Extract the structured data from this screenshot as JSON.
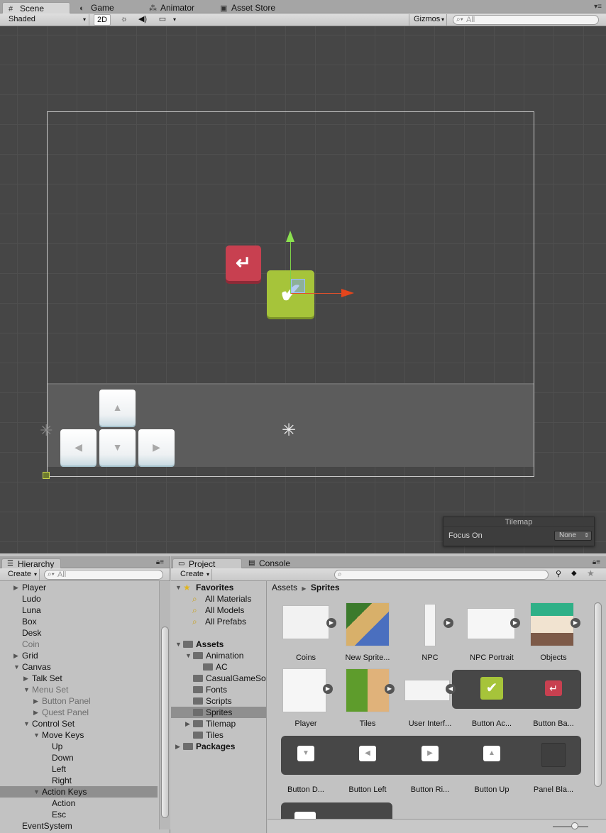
{
  "tabs": [
    {
      "label": "Scene",
      "icon": "grid-icon"
    },
    {
      "label": "Game",
      "icon": "pacman-icon"
    },
    {
      "label": "Animator",
      "icon": "animator-icon"
    },
    {
      "label": "Asset Store",
      "icon": "store-icon"
    }
  ],
  "toolbar": {
    "shading": "Shaded",
    "mode2d": "2D",
    "gizmos": "Gizmos",
    "search_placeholder": "All"
  },
  "tilemap": {
    "title": "Tilemap",
    "focus_label": "Focus On",
    "focus_value": "None"
  },
  "hierarchy": {
    "tab": "Hierarchy",
    "create": "Create",
    "search_placeholder": "All",
    "items": [
      {
        "label": "Player",
        "depth": 0,
        "arrow": "right",
        "muted": false
      },
      {
        "label": "Ludo",
        "depth": 0,
        "arrow": "",
        "muted": false
      },
      {
        "label": "Luna",
        "depth": 0,
        "arrow": "",
        "muted": false
      },
      {
        "label": "Box",
        "depth": 0,
        "arrow": "",
        "muted": false
      },
      {
        "label": "Desk",
        "depth": 0,
        "arrow": "",
        "muted": false
      },
      {
        "label": "Coin",
        "depth": 0,
        "arrow": "",
        "muted": true
      },
      {
        "label": "Grid",
        "depth": 0,
        "arrow": "right",
        "muted": false
      },
      {
        "label": "Canvas",
        "depth": 0,
        "arrow": "down",
        "muted": false
      },
      {
        "label": "Talk Set",
        "depth": 1,
        "arrow": "right",
        "muted": false
      },
      {
        "label": "Menu Set",
        "depth": 1,
        "arrow": "down",
        "muted": true
      },
      {
        "label": "Button Panel",
        "depth": 2,
        "arrow": "right",
        "muted": true
      },
      {
        "label": "Quest Panel",
        "depth": 2,
        "arrow": "right",
        "muted": true
      },
      {
        "label": "Control Set",
        "depth": 1,
        "arrow": "down",
        "muted": false
      },
      {
        "label": "Move Keys",
        "depth": 2,
        "arrow": "down",
        "muted": false
      },
      {
        "label": "Up",
        "depth": 3,
        "arrow": "",
        "muted": false
      },
      {
        "label": "Down",
        "depth": 3,
        "arrow": "",
        "muted": false
      },
      {
        "label": "Left",
        "depth": 3,
        "arrow": "",
        "muted": false
      },
      {
        "label": "Right",
        "depth": 3,
        "arrow": "",
        "muted": false
      },
      {
        "label": "Action Keys",
        "depth": 2,
        "arrow": "down",
        "muted": false,
        "selected": true
      },
      {
        "label": "Action",
        "depth": 3,
        "arrow": "",
        "muted": false
      },
      {
        "label": "Esc",
        "depth": 3,
        "arrow": "",
        "muted": false
      },
      {
        "label": "EventSystem",
        "depth": 0,
        "arrow": "",
        "muted": false
      }
    ]
  },
  "project": {
    "tab": "Project",
    "console_tab": "Console",
    "create": "Create",
    "favorites": {
      "label": "Favorites",
      "items": [
        "All Materials",
        "All Models",
        "All Prefabs"
      ]
    },
    "tree": [
      {
        "label": "Assets",
        "depth": 0,
        "bold": true,
        "arrow": "down"
      },
      {
        "label": "Animation",
        "depth": 1,
        "arrow": "down"
      },
      {
        "label": "AC",
        "depth": 2,
        "arrow": ""
      },
      {
        "label": "CasualGameSounds",
        "depth": 1,
        "arrow": ""
      },
      {
        "label": "Fonts",
        "depth": 1,
        "arrow": ""
      },
      {
        "label": "Scripts",
        "depth": 1,
        "arrow": ""
      },
      {
        "label": "Sprites",
        "depth": 1,
        "arrow": "",
        "selected": true
      },
      {
        "label": "Tilemap",
        "depth": 1,
        "arrow": "right"
      },
      {
        "label": "Tiles",
        "depth": 1,
        "arrow": ""
      },
      {
        "label": "Packages",
        "depth": 0,
        "bold": true,
        "arrow": "right"
      }
    ],
    "breadcrumb": {
      "root": "Assets",
      "current": "Sprites"
    },
    "assets": [
      "Coins",
      "New Sprite...",
      "NPC",
      "NPC Portrait",
      "Objects",
      "Player",
      "Tiles",
      "User Interf...",
      "Button Ac...",
      "Button Ba...",
      "Button D...",
      "Button Left",
      "Button Ri...",
      "Button Up",
      "Panel Bla..."
    ]
  }
}
